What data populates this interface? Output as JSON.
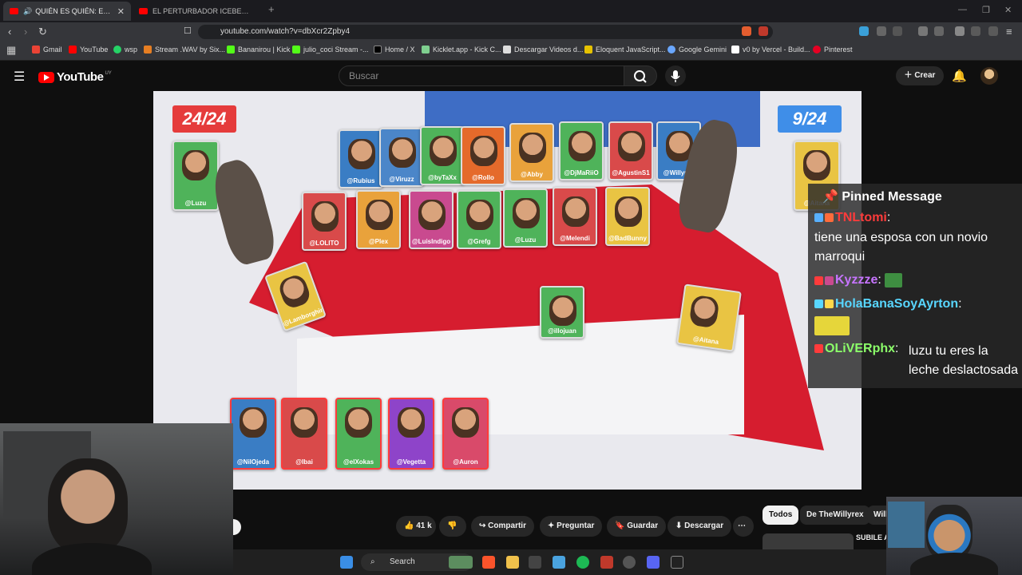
{
  "browser": {
    "tabs": [
      {
        "title": "QUIÉN ES QUIÉN: EDICIÓN FAMOSOS",
        "active": true
      },
      {
        "title": "EL PERTURBADOR ICEBERG DE LOS ADOLESCENTES",
        "active": false
      }
    ],
    "new_tab": "+",
    "url": "youtube.com/watch?v=dbXcr2Zpby4",
    "bookmarks": [
      "Gmail",
      "YouTube",
      "wsp",
      "Stream .WAV by Six...",
      "Bananirou | Kick",
      "julio_coci Stream -...",
      "Home / X",
      "Kicklet.app - Kick C...",
      "Descargar Videos d...",
      "Eloquent JavaScript...",
      "Google Gemini",
      "v0 by Vercel - Build...",
      "Pinterest"
    ]
  },
  "youtube": {
    "logo": "YouTube",
    "country": "UY",
    "search_placeholder": "Buscar",
    "create_label": "Crear"
  },
  "video": {
    "score_left": "24/24",
    "score_right": "9/24",
    "player_card_left": "@Luzu",
    "player_card_right": "@Aitana",
    "board_row1": [
      "@Rubius",
      "@Viruzz",
      "@byTaXx",
      "@Rollo",
      "@Abby",
      "@DjMaRiiO",
      "@AgustinS1",
      "@Willyrex"
    ],
    "board_row2": [
      "@LOLITO",
      "@Plex",
      "@LuisIndigo",
      "@Grefg",
      "@Luzu",
      "@Melendi",
      "@BadBunny"
    ],
    "floor_cards": [
      "@Lamborghini",
      "@illojuan",
      "@Aitana"
    ],
    "eliminated": [
      "@NilOjeda",
      "@Ibai",
      "@elXokas",
      "@Vegetta",
      "@Auron"
    ]
  },
  "chat": {
    "header": "Pinned Message",
    "messages": [
      {
        "user": "TNLtomi",
        "text": "tiene una esposa con un novio marroqui",
        "user_color": "#ff3b3b"
      },
      {
        "user": "Kyzzze",
        "text": "",
        "user_color": "#c774ff"
      },
      {
        "user": "HolaBanaSoyAyrton",
        "text": "",
        "user_color": "#58d6ff"
      },
      {
        "user": "OLiVERphx",
        "text": "luzu tu eres la leche deslactosada",
        "user_color": "#8cff6a"
      }
    ]
  },
  "actions": {
    "likes": "41 k",
    "share": "Compartir",
    "ask": "Preguntar",
    "save": "Guardar",
    "download": "Descargar",
    "more": "⋯"
  },
  "chips": [
    "Todos",
    "De TheWillyrex",
    "Willy"
  ],
  "recommendation": "SUBILE A",
  "taskbar": {
    "search": "Search"
  }
}
